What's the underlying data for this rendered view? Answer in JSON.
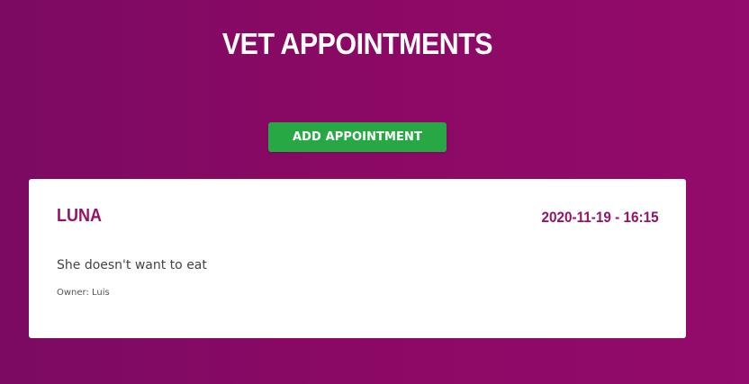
{
  "header": {
    "title": "VET APPOINTMENTS"
  },
  "toolbar": {
    "add_label": "ADD APPOINTMENT"
  },
  "appointments": [
    {
      "pet_name": "LUNA",
      "date": "2020-11-19 - 16:15",
      "symptoms": "She doesn't want to eat",
      "owner": "Owner: Luis"
    }
  ],
  "colors": {
    "background_start": "#7b0a63",
    "background_end": "#930b6c",
    "button": "#28a745",
    "accent_text": "#951468",
    "card": "#ffffff"
  }
}
